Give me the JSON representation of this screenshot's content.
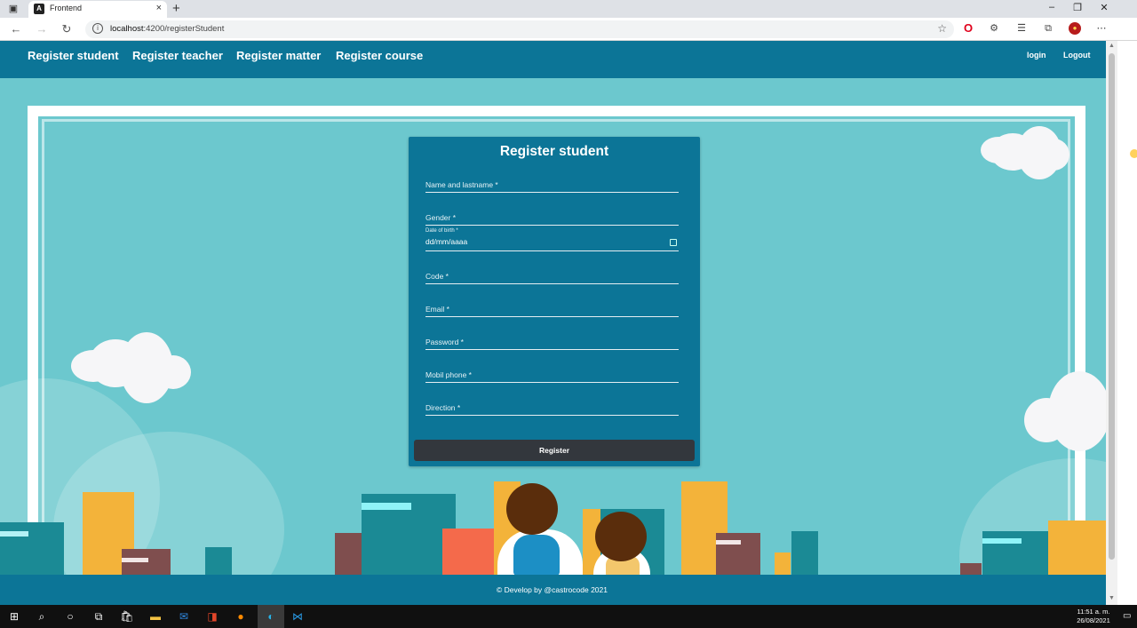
{
  "browser": {
    "tab_title": "Frontend",
    "tab_favicon": "A",
    "url_host": "localhost",
    "url_path": ":4200/registerStudent",
    "new_tab": "+",
    "tab_close": "×",
    "win_minimize": "–",
    "win_restore": "❐",
    "win_close": "✕"
  },
  "navbar": {
    "links": [
      "Register student",
      "Register teacher",
      "Register matter",
      "Register course"
    ],
    "login": "login",
    "logout": "Logout"
  },
  "form": {
    "title": "Register student",
    "fields": {
      "name": "Name and lastname *",
      "gender": "Gender *",
      "dob_label": "Date of birth *",
      "dob_value": "dd/mm/aaaa",
      "code": "Code *",
      "email": "Email *",
      "password": "Password *",
      "mobile": "Mobil phone *",
      "direction": "Direction *"
    },
    "submit": "Register"
  },
  "footer": {
    "text": "© Develop by @castrocode 2021"
  },
  "taskbar": {
    "time": "11:51 a. m.",
    "date": "26/08/2021"
  },
  "colors": {
    "primary": "#0c7597",
    "background": "#6cc8ce",
    "button": "#33373d"
  }
}
